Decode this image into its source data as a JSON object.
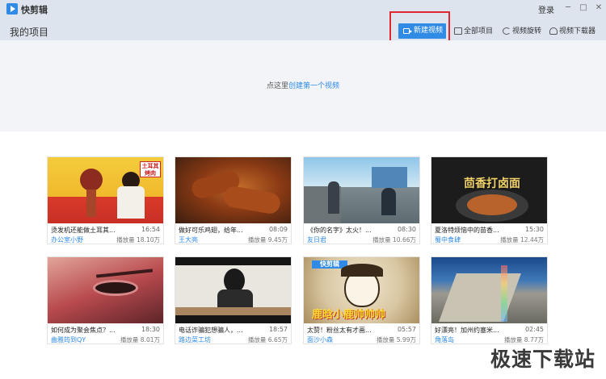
{
  "app": {
    "name": "快剪辑",
    "login": "登录"
  },
  "window": {
    "minimize": "─",
    "maximize": "□",
    "close": "✕"
  },
  "toolbar": {
    "page_title": "我的项目",
    "new_video": "新建视频",
    "all_projects": "全部项目",
    "rotate": "视频旋转",
    "downloader": "视频下载器"
  },
  "empty": {
    "prefix": "点这里",
    "link": "创建第一个视频"
  },
  "cards": [
    {
      "title": "烫发机还能做土耳其...",
      "duration": "16:54",
      "author": "办公室小野",
      "views": "播放量 18.10万",
      "thumb_label": "土耳其烤肉"
    },
    {
      "title": "做好可乐鸡翅，给年...",
      "duration": "08:09",
      "author": "王大亮",
      "views": "播放量 9.45万",
      "thumb_label": ""
    },
    {
      "title": "《你的名字》太火！...",
      "duration": "08:30",
      "author": "友日君",
      "views": "播放量 10.66万",
      "thumb_label": ""
    },
    {
      "title": "夏洛特烦恼中的苗香...",
      "duration": "15:30",
      "author": "蜀中食肆",
      "views": "播放量 12.44万",
      "thumb_label": "茴香打卤面"
    },
    {
      "title": "如何成为聚会焦点？...",
      "duration": "18:30",
      "author": "曲雅筠到QY",
      "views": "播放量 8.01万",
      "thumb_label": ""
    },
    {
      "title": "电话诈骗犯想骗人，...",
      "duration": "18:57",
      "author": "路边菜工坊",
      "views": "播放量 6.65万",
      "thumb_label": ""
    },
    {
      "title": "太赞！粉丝太有才画...",
      "duration": "05:57",
      "author": "面沙小森",
      "views": "播放量 5.99万",
      "thumb_label": "鹿晗小鹿帅帅帅"
    },
    {
      "title": "好漂亮！加州约塞米...",
      "duration": "02:45",
      "author": "角落岛",
      "views": "播放量 8.77万",
      "thumb_label": ""
    }
  ],
  "watermark": "极速下载站",
  "colors": {
    "accent": "#2f8be6",
    "highlight": "#e0262f",
    "chrome": "#dde4ee"
  }
}
